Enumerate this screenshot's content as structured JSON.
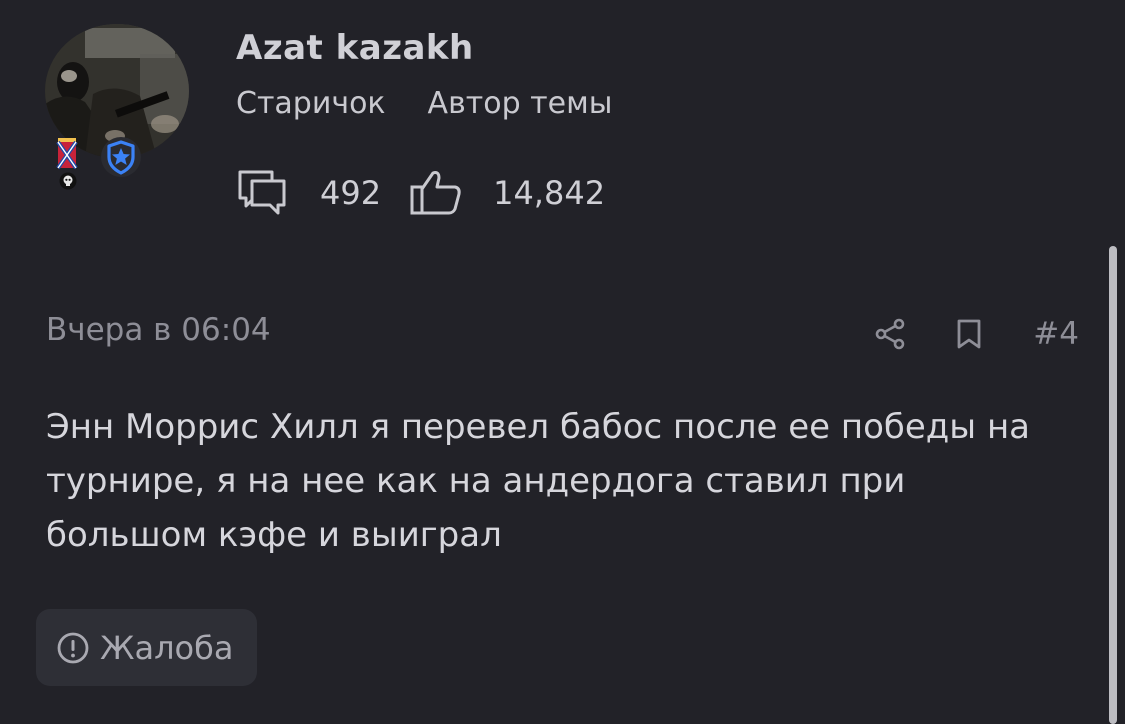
{
  "user": {
    "name": "Azat kazakh",
    "rank": "Старичок",
    "role_badge": "Автор темы",
    "messages_count": "492",
    "likes_count": "14,842"
  },
  "post": {
    "date": "Вчера в 06:04",
    "number": "#4",
    "text": "Энн Моррис Хилл я перевел бабос после ее победы на турнире, я на нее как на андердога ставил при большом кэфе и выиграл",
    "report_label": "Жалоба"
  },
  "colors": {
    "background": "#222228",
    "shield_badge": "#3b82f6",
    "report_button_bg": "#2e2f36"
  },
  "icons": [
    "messages-icon",
    "like-icon",
    "share-icon",
    "bookmark-icon",
    "report-icon",
    "shield-star-icon"
  ]
}
